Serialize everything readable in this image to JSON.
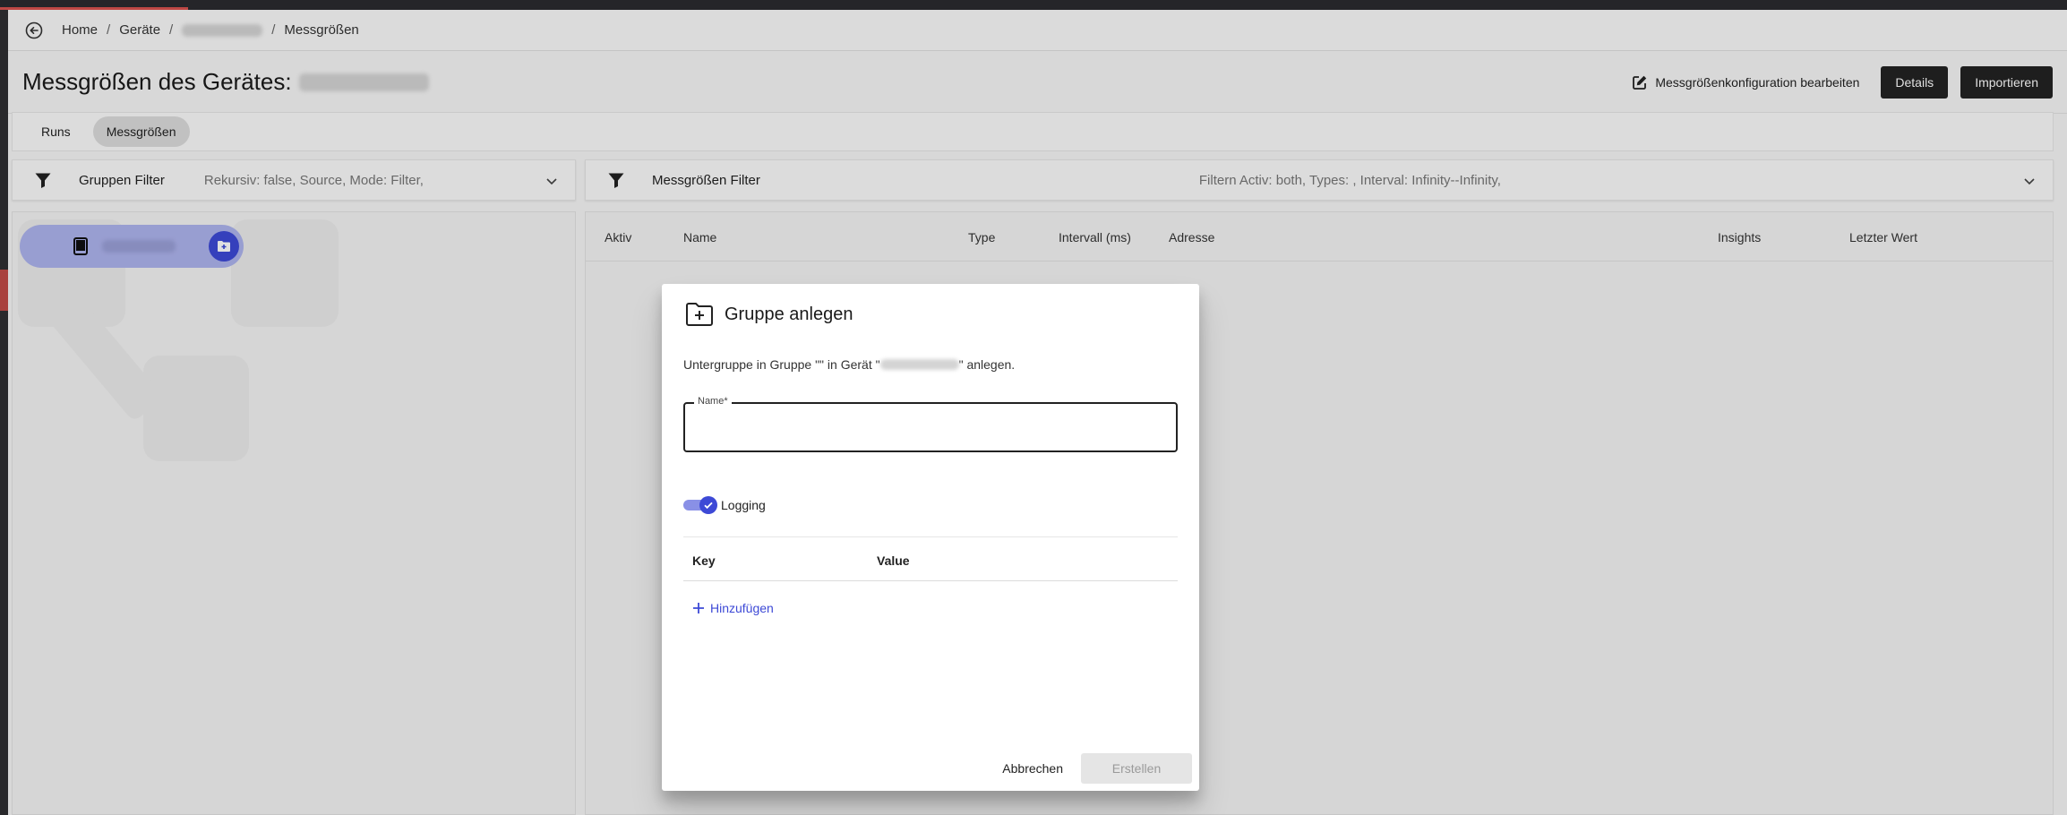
{
  "breadcrumb": {
    "home": "Home",
    "devices": "Geräte",
    "current": "Messgrößen",
    "separator": "/"
  },
  "page": {
    "title": "Messgrößen des Gerätes:",
    "edit_config_label": "Messgrößenkonfiguration bearbeiten",
    "details_label": "Details",
    "import_label": "Importieren"
  },
  "tabs": [
    {
      "label": "Runs",
      "active": false
    },
    {
      "label": "Messgrößen",
      "active": true
    }
  ],
  "group_filter": {
    "title": "Gruppen Filter",
    "summary": "Rekursiv: false, Source, Mode: Filter,"
  },
  "measure_filter": {
    "title": "Messgrößen Filter",
    "summary": "Filtern Activ: both, Types: , Interval: Infinity--Infinity,"
  },
  "table": {
    "columns": [
      "Aktiv",
      "Name",
      "Type",
      "Intervall (ms)",
      "Adresse",
      "Insights",
      "Letzter Wert"
    ]
  },
  "dialog": {
    "title": "Gruppe anlegen",
    "desc_prefix": "Untergruppe in Gruppe \"\" in Gerät \"",
    "desc_suffix": "\" anlegen.",
    "name_label": "Name*",
    "name_value": "",
    "logging_label": "Logging",
    "logging_on": true,
    "kv_key_header": "Key",
    "kv_value_header": "Value",
    "add_label": "Hinzufügen",
    "cancel_label": "Abbrechen",
    "create_label": "Erstellen"
  },
  "colors": {
    "accent": "#3d49d6",
    "accent_light": "#aeb4ee",
    "dark_button": "#232323"
  }
}
